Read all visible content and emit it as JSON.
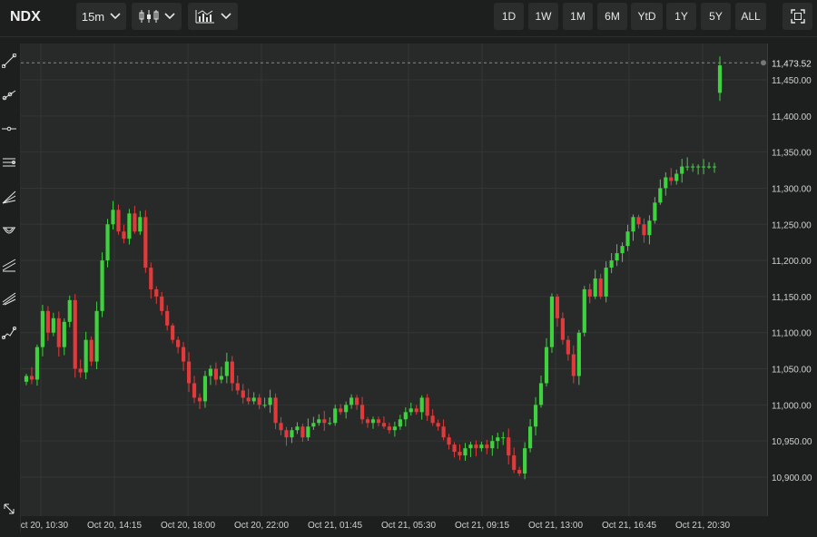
{
  "header": {
    "symbol": "NDX",
    "interval_label": "15m",
    "chart_type_icon": "candlestick-icon",
    "indicators_icon": "indicators-icon",
    "ranges": [
      "1D",
      "1W",
      "1M",
      "6M",
      "YtD",
      "1Y",
      "5Y",
      "ALL"
    ],
    "fullscreen_icon": "fullscreen-icon"
  },
  "left_tools": [
    "trend-line-icon",
    "ray-icon",
    "horizontal-line-icon",
    "parallel-channel-icon",
    "fan-icon",
    "arc-icon",
    "regression-channel-icon",
    "pitchfork-icon",
    "path-icon"
  ],
  "bottom_tool": "measure-icon",
  "colors": {
    "up": "#3fd23f",
    "down": "#e23a3a",
    "bg": "#282929",
    "grid": "#343535",
    "crosshair": "#8a8a8a"
  },
  "chart_data": {
    "type": "candlestick",
    "interval": "15m",
    "y_ticks": [
      "11,450.00",
      "11,400.00",
      "11,350.00",
      "11,300.00",
      "11,250.00",
      "11,200.00",
      "11,150.00",
      "11,100.00",
      "11,050.00",
      "11,000.00",
      "10,950.00",
      "10,900.00"
    ],
    "y_tick_values": [
      11450,
      11400,
      11350,
      11300,
      11250,
      11200,
      11150,
      11100,
      11050,
      11000,
      10950,
      10900
    ],
    "ylim": [
      10870,
      11500
    ],
    "current_price_label": "11,473.52",
    "current_price": 11473.52,
    "x_tick_labels": [
      "Oct 20, 10:30",
      "Oct 20, 14:15",
      "Oct 20, 18:00",
      "Oct 20, 22:00",
      "Oct 21, 01:45",
      "Oct 21, 05:30",
      "Oct 21, 09:15",
      "Oct 21, 13:00",
      "Oct 21, 16:45",
      "Oct 21, 20:30"
    ],
    "closes": [
      11040,
      11035,
      11080,
      11130,
      11100,
      11120,
      11080,
      11115,
      11145,
      11050,
      11045,
      11090,
      11060,
      11130,
      11200,
      11250,
      11270,
      11240,
      11230,
      11265,
      11240,
      11260,
      11190,
      11160,
      11150,
      11130,
      11110,
      11090,
      11080,
      11060,
      11030,
      11010,
      11005,
      11040,
      11050,
      11035,
      11040,
      11060,
      11030,
      11020,
      11010,
      11005,
      11010,
      11000,
      11000,
      11010,
      10975,
      10965,
      10955,
      10965,
      10970,
      10955,
      10970,
      10975,
      10980,
      10975,
      10975,
      10995,
      10990,
      11000,
      11010,
      11000,
      10980,
      10975,
      10980,
      10975,
      10970,
      10965,
      10970,
      10980,
      10990,
      10995,
      10990,
      11010,
      10985,
      10975,
      10970,
      10955,
      10945,
      10935,
      10930,
      10940,
      10945,
      10940,
      10945,
      10940,
      10950,
      10955,
      10955,
      10930,
      10910,
      10905,
      10940,
      10970,
      11000,
      11030,
      11080,
      11150,
      11120,
      11090,
      11070,
      11040,
      11100,
      11160,
      11150,
      11175,
      11150,
      11190,
      11200,
      11210,
      11220,
      11240,
      11260,
      11250,
      11235,
      11255,
      11280,
      11300,
      11315,
      11310,
      11320,
      11330,
      11330,
      11330,
      11330,
      11330,
      11330,
      11330,
      11470
    ],
    "x_labels_note": ""
  }
}
